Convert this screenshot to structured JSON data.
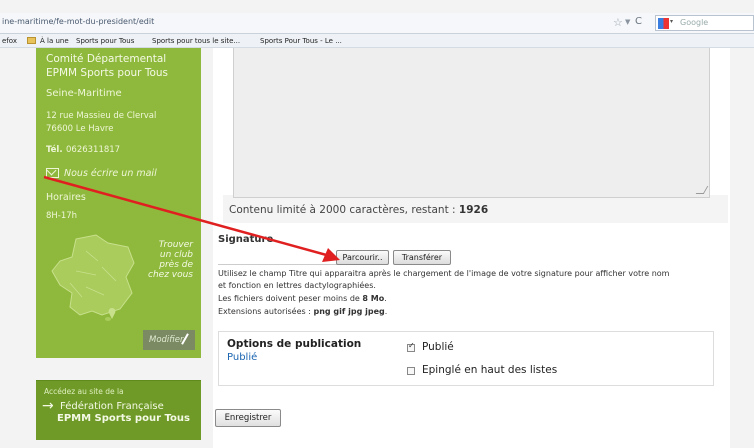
{
  "browser": {
    "url": "ine-maritime/fe-mot-du-president/edit",
    "search_placeholder": "Google",
    "bookmarks": [
      "efox",
      "À la une",
      "Sports pour Tous",
      "Sports pour tous le site...",
      "Sports Pour Tous - Le ..."
    ]
  },
  "sidebar": {
    "org_line1": "Comité Départemental",
    "org_line2": "EPMM Sports pour Tous",
    "region": "Seine-Maritime",
    "address_line1": "12 rue Massieu de Clerval",
    "address_line2": "76600 Le Havre",
    "phone_label": "Tél.",
    "phone": "0626311817",
    "mail_link": "Nous écrire un mail",
    "hours_label": "Horaires",
    "hours": "8H-17h",
    "find_club": [
      "Trouver",
      "un club",
      "près de",
      "chez vous"
    ],
    "edit_label": "Modifier"
  },
  "federation": {
    "intro": "Accédez au site de la",
    "line1": "Fédération Française",
    "line2": "EPMM Sports pour Tous"
  },
  "form": {
    "counter_text": "Contenu limité à 2000 caractères, restant :",
    "counter_value": "1926",
    "signature_label": "Signature",
    "browse_label": "Parcourir..",
    "upload_label": "Transférer",
    "help_line1": "Utilisez le champ Titre qui apparaitra après le chargement de l'image de votre signature pour afficher votre nom",
    "help_line2": "et fonction en lettres dactylographiées.",
    "help_line3_pre": "Les fichiers doivent peser moins de",
    "help_line3_bold": "8 Mo",
    "help_line4_pre": "Extensions autorisées :",
    "help_line4_bold": "png gif jpg jpeg",
    "options_title": "Options de publication",
    "options_status": "Publié",
    "opt_published_label": "Publié",
    "opt_published_checked": true,
    "opt_pinned_label": "Epinglé en haut des listes",
    "opt_pinned_checked": false,
    "save_label": "Enregistrer"
  },
  "annotation": {
    "color": "#e02020"
  }
}
